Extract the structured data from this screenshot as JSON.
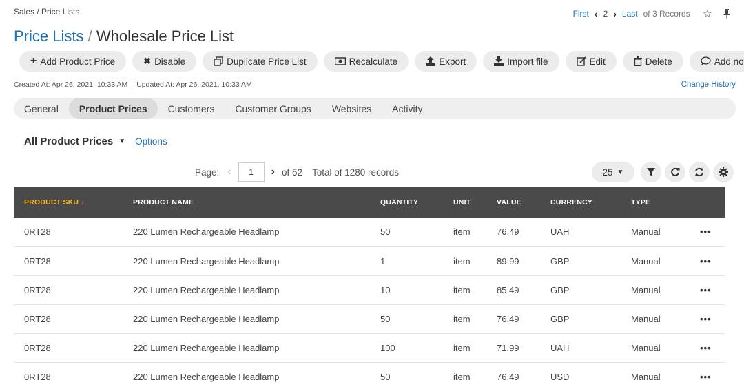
{
  "breadcrumb": "Sales / Price Lists",
  "navigation": {
    "first": "First",
    "current": "2",
    "last": "Last",
    "records": "of 3 Records"
  },
  "title": {
    "parent": "Price Lists",
    "separator": "/",
    "current": "Wholesale Price List"
  },
  "actions": [
    {
      "label": "Add Product Price",
      "icon": "plus-icon"
    },
    {
      "label": "Disable",
      "icon": "close-icon"
    },
    {
      "label": "Duplicate Price List",
      "icon": "duplicate-icon"
    },
    {
      "label": "Recalculate",
      "icon": "money-icon"
    },
    {
      "label": "Export",
      "icon": "upload-icon"
    },
    {
      "label": "Import file",
      "icon": "download-icon"
    },
    {
      "label": "Edit",
      "icon": "edit-icon"
    },
    {
      "label": "Delete",
      "icon": "trash-icon"
    },
    {
      "label": "Add note",
      "icon": "comment-icon"
    }
  ],
  "meta": {
    "created": "Created At: Apr 26, 2021, 10:33 AM",
    "updated": "Updated At: Apr 26, 2021, 10:33 AM",
    "change_history": "Change History"
  },
  "tabs": [
    {
      "label": "General",
      "active": false
    },
    {
      "label": "Product Prices",
      "active": true
    },
    {
      "label": "Customers",
      "active": false
    },
    {
      "label": "Customer Groups",
      "active": false
    },
    {
      "label": "Websites",
      "active": false
    },
    {
      "label": "Activity",
      "active": false
    }
  ],
  "grid": {
    "view_name": "All Product Prices",
    "options": "Options",
    "page_label": "Page:",
    "page_value": "1",
    "of_pages": "of 52",
    "total": "Total of 1280 records",
    "page_size": "25"
  },
  "table": {
    "columns": [
      "PRODUCT SKU",
      "PRODUCT NAME",
      "QUANTITY",
      "UNIT",
      "VALUE",
      "CURRENCY",
      "TYPE"
    ],
    "sort_arrow": "↓",
    "sorted_color": "#f4b323",
    "rows": [
      {
        "sku": "0RT28",
        "name": "220 Lumen Rechargeable Headlamp",
        "qty": "50",
        "unit": "item",
        "value": "76.49",
        "currency": "UAH",
        "type": "Manual"
      },
      {
        "sku": "0RT28",
        "name": "220 Lumen Rechargeable Headlamp",
        "qty": "1",
        "unit": "item",
        "value": "89.99",
        "currency": "GBP",
        "type": "Manual"
      },
      {
        "sku": "0RT28",
        "name": "220 Lumen Rechargeable Headlamp",
        "qty": "10",
        "unit": "item",
        "value": "85.49",
        "currency": "GBP",
        "type": "Manual"
      },
      {
        "sku": "0RT28",
        "name": "220 Lumen Rechargeable Headlamp",
        "qty": "50",
        "unit": "item",
        "value": "76.49",
        "currency": "GBP",
        "type": "Manual"
      },
      {
        "sku": "0RT28",
        "name": "220 Lumen Rechargeable Headlamp",
        "qty": "100",
        "unit": "item",
        "value": "71.99",
        "currency": "UAH",
        "type": "Manual"
      },
      {
        "sku": "0RT28",
        "name": "220 Lumen Rechargeable Headlamp",
        "qty": "50",
        "unit": "item",
        "value": "76.49",
        "currency": "USD",
        "type": "Manual"
      }
    ],
    "row_action": "•••"
  },
  "colors": {
    "link": "#1f6fb2",
    "header_bg": "#4a4a4a"
  }
}
